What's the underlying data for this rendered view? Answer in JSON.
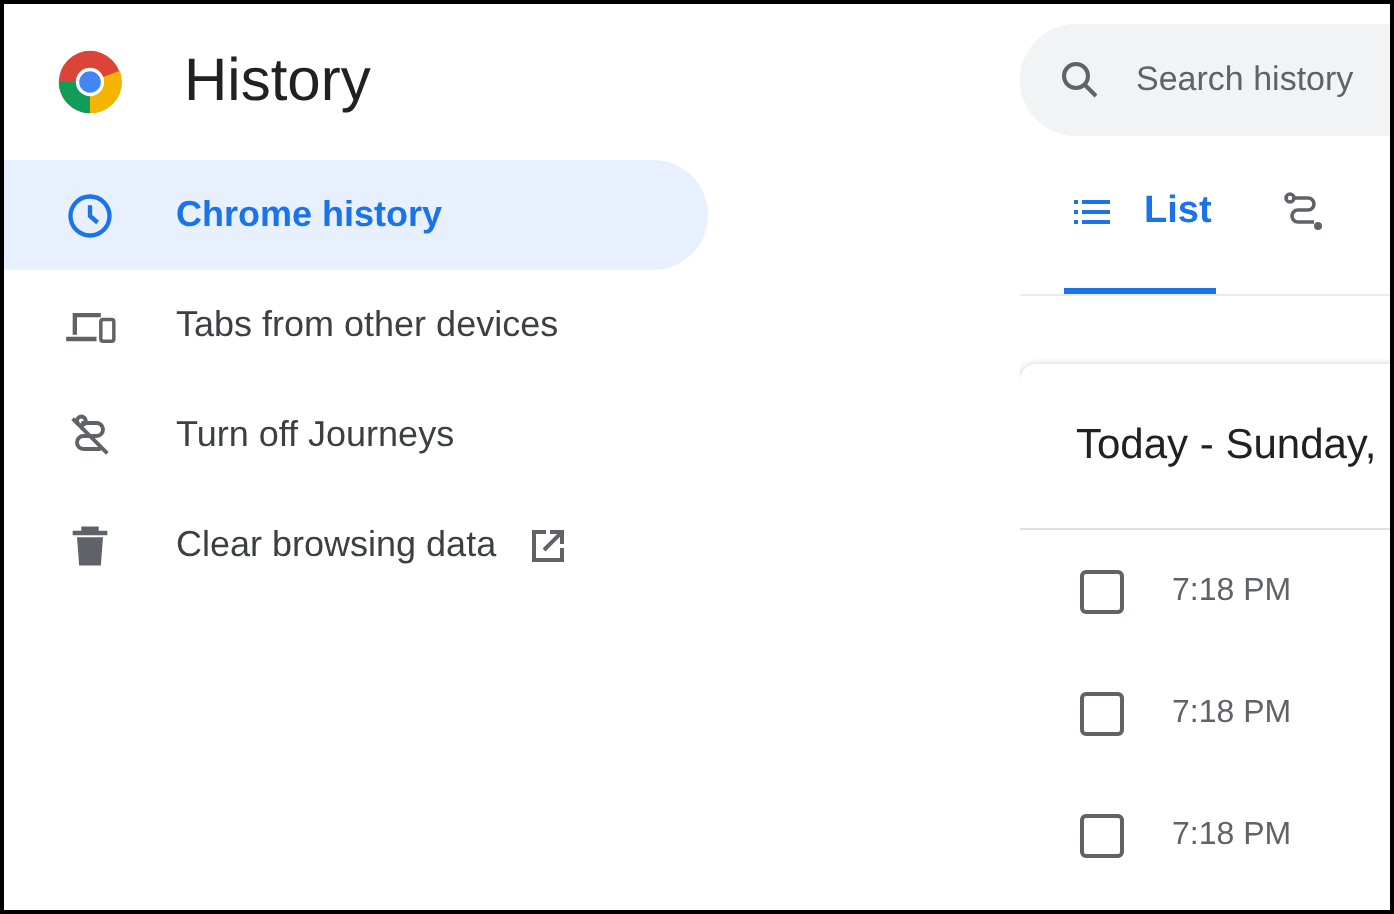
{
  "header": {
    "title": "History"
  },
  "sidebar": {
    "items": [
      {
        "kind": "clock",
        "label": "Chrome history",
        "selected": true,
        "external": false
      },
      {
        "kind": "devices",
        "label": "Tabs from other devices",
        "selected": false,
        "external": false
      },
      {
        "kind": "journeys-off",
        "label": "Turn off Journeys",
        "selected": false,
        "external": false
      },
      {
        "kind": "trash",
        "label": "Clear browsing data",
        "selected": false,
        "external": true
      }
    ]
  },
  "search": {
    "placeholder": "Search history"
  },
  "tabs": [
    {
      "kind": "list",
      "label": "List",
      "selected": true
    },
    {
      "kind": "journeys",
      "selected": false
    }
  ],
  "card": {
    "heading": "Today - Sunday,",
    "rows": [
      {
        "time": "7:18 PM",
        "checked": false
      },
      {
        "time": "7:18 PM",
        "checked": false
      },
      {
        "time": "7:18 PM",
        "checked": false
      }
    ]
  }
}
